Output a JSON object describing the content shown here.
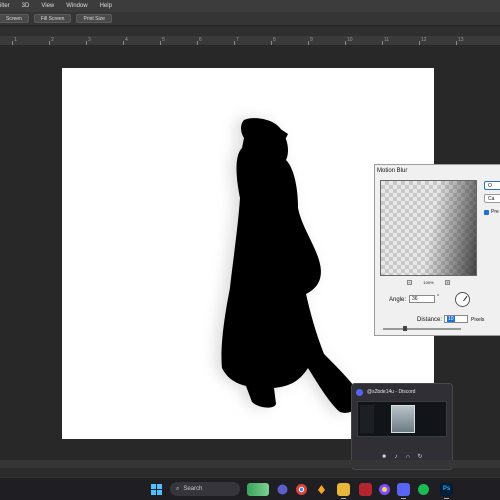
{
  "menu": [
    "ilter",
    "3D",
    "View",
    "Window",
    "Help"
  ],
  "options": [
    "Screen",
    "Fill Screen",
    "Print Size"
  ],
  "ruler_ticks": [
    "1",
    "2",
    "3",
    "4",
    "5",
    "6",
    "7",
    "8",
    "9",
    "10",
    "11",
    "12",
    "13"
  ],
  "dialog": {
    "title": "Motion Blur",
    "ok_label": "O",
    "cancel_label": "Ca",
    "preview_label": "Pre",
    "zoom_out": "−",
    "zoom_level": "100%",
    "zoom_in": "+",
    "angle_label": "Angle:",
    "angle_value": "36",
    "angle_unit": "°",
    "distance_label": "Distance:",
    "distance_value": "10",
    "distance_unit": "Pixels"
  },
  "discord": {
    "title": "@s2bde14u - Discord"
  },
  "taskbar": {
    "search_placeholder": "Search",
    "search_icon": "magnifier-icon"
  },
  "colors": {
    "canvas": "#ffffff",
    "workspace": "#282828",
    "accent": "#1e6fd9",
    "discord": "#5865f2"
  }
}
